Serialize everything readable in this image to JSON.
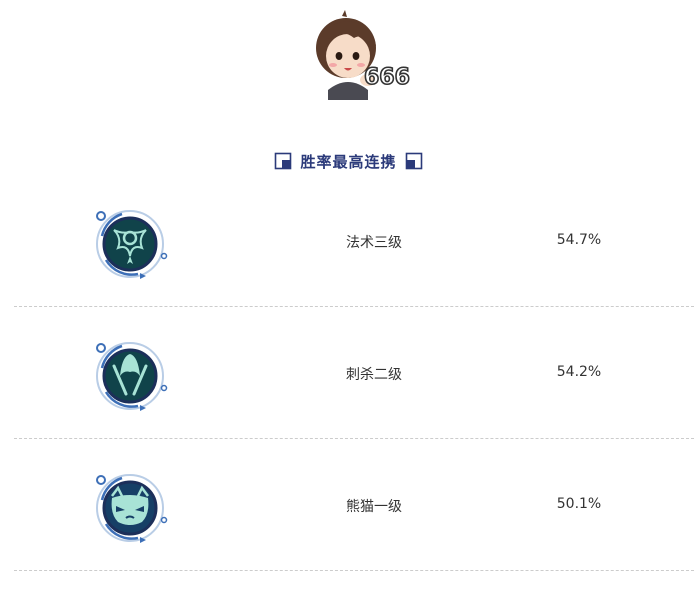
{
  "header": {
    "sticker_caption": "666",
    "title": "胜率最高连携"
  },
  "combos": [
    {
      "name": "法术三级",
      "rate": "54.7%",
      "icon": "mage-emblem-icon"
    },
    {
      "name": "刺杀二级",
      "rate": "54.2%",
      "icon": "assassin-emblem-icon"
    },
    {
      "name": "熊猫一级",
      "rate": "50.1%",
      "icon": "panda-emblem-icon"
    }
  ],
  "colors": {
    "title": "#2b3a7a",
    "emblem_ring": "#3d6fb7",
    "emblem_fill_green": "#10434a",
    "emblem_fill_blue": "#163f66",
    "emblem_symbol": "#a8e3d6"
  }
}
